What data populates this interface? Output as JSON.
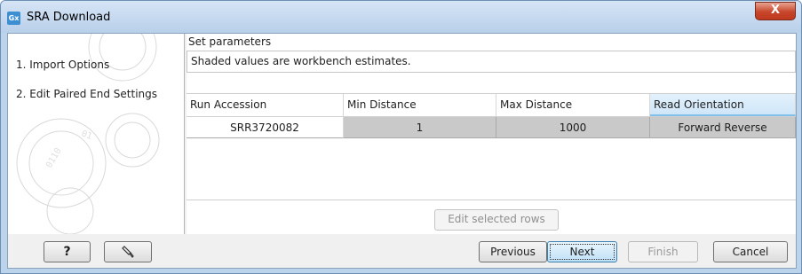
{
  "window": {
    "app_icon_text": "Gx",
    "title": "SRA Download",
    "close_glyph": "X"
  },
  "steps": [
    {
      "label": "1.  Import Options"
    },
    {
      "label": "2.  Edit Paired End Settings"
    }
  ],
  "panel": {
    "section_title": "Set parameters",
    "hint": "Shaded values are workbench estimates."
  },
  "table": {
    "columns": [
      "Run Accession",
      "Min Distance",
      "Max Distance",
      "Read Orientation"
    ],
    "rows": [
      {
        "run_accession": "SRR3720082",
        "min_distance": "1",
        "max_distance": "1000",
        "read_orientation": "Forward Reverse"
      }
    ]
  },
  "edit_button": "Edit selected rows",
  "footer": {
    "help": "?",
    "restore_icon": "restore-icon",
    "previous": "Previous",
    "next": "Next",
    "finish": "Finish",
    "cancel": "Cancel"
  }
}
